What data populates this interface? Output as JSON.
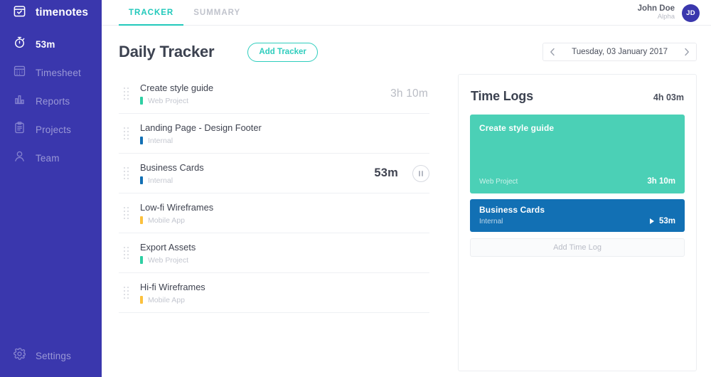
{
  "sidebar": {
    "brand": {
      "name": "timenotes",
      "icon": "calendar-check-icon"
    },
    "items": [
      {
        "label": "53m",
        "icon": "stopwatch-icon",
        "active": true
      },
      {
        "label": "Timesheet",
        "icon": "calendar-icon",
        "active": false
      },
      {
        "label": "Reports",
        "icon": "bar-chart-icon",
        "active": false
      },
      {
        "label": "Projects",
        "icon": "clipboard-icon",
        "active": false
      },
      {
        "label": "Team",
        "icon": "user-icon",
        "active": false
      }
    ],
    "settings": {
      "label": "Settings",
      "icon": "gear-icon"
    },
    "color": "#3a37ad"
  },
  "topbar": {
    "tabs": [
      {
        "label": "TRACKER",
        "active": true
      },
      {
        "label": "SUMMARY",
        "active": false
      }
    ],
    "user": {
      "name": "John Doe",
      "role": "Alpha",
      "initials": "JD"
    },
    "accent": "#22c9bb"
  },
  "header": {
    "title": "Daily Tracker",
    "add_tracker_label": "Add Tracker",
    "date": "Tuesday, 03 January 2017",
    "prev_icon": "chevron-left-icon",
    "next_icon": "chevron-right-icon"
  },
  "tasks": [
    {
      "name": "Create style guide",
      "project": "Web Project",
      "color": "#2ecfa3",
      "time": "3h 10m",
      "running": false
    },
    {
      "name": "Landing Page - Design Footer",
      "project": "Internal",
      "color": "#1270b4",
      "time": "",
      "running": false
    },
    {
      "name": "Business Cards",
      "project": "Internal",
      "color": "#1270b4",
      "time": "53m",
      "running": true
    },
    {
      "name": "Low-fi Wireframes",
      "project": "Mobile App",
      "color": "#fcc13d",
      "time": "",
      "running": false
    },
    {
      "name": "Export Assets",
      "project": "Web Project",
      "color": "#2ecfa3",
      "time": "",
      "running": false
    },
    {
      "name": "Hi-fi Wireframes",
      "project": "Mobile App",
      "color": "#fcc13d",
      "time": "",
      "running": false
    }
  ],
  "time_logs": {
    "title": "Time Logs",
    "total": "4h 03m",
    "add_label": "Add Time Log",
    "entries": [
      {
        "name": "Create style guide",
        "project": "Web Project",
        "duration": "3h 10m",
        "color": "#4bd0b6",
        "size": "big",
        "playing": false
      },
      {
        "name": "Business Cards",
        "project": "Internal",
        "duration": "53m",
        "color": "#1270b4",
        "size": "small",
        "playing": true
      }
    ]
  }
}
